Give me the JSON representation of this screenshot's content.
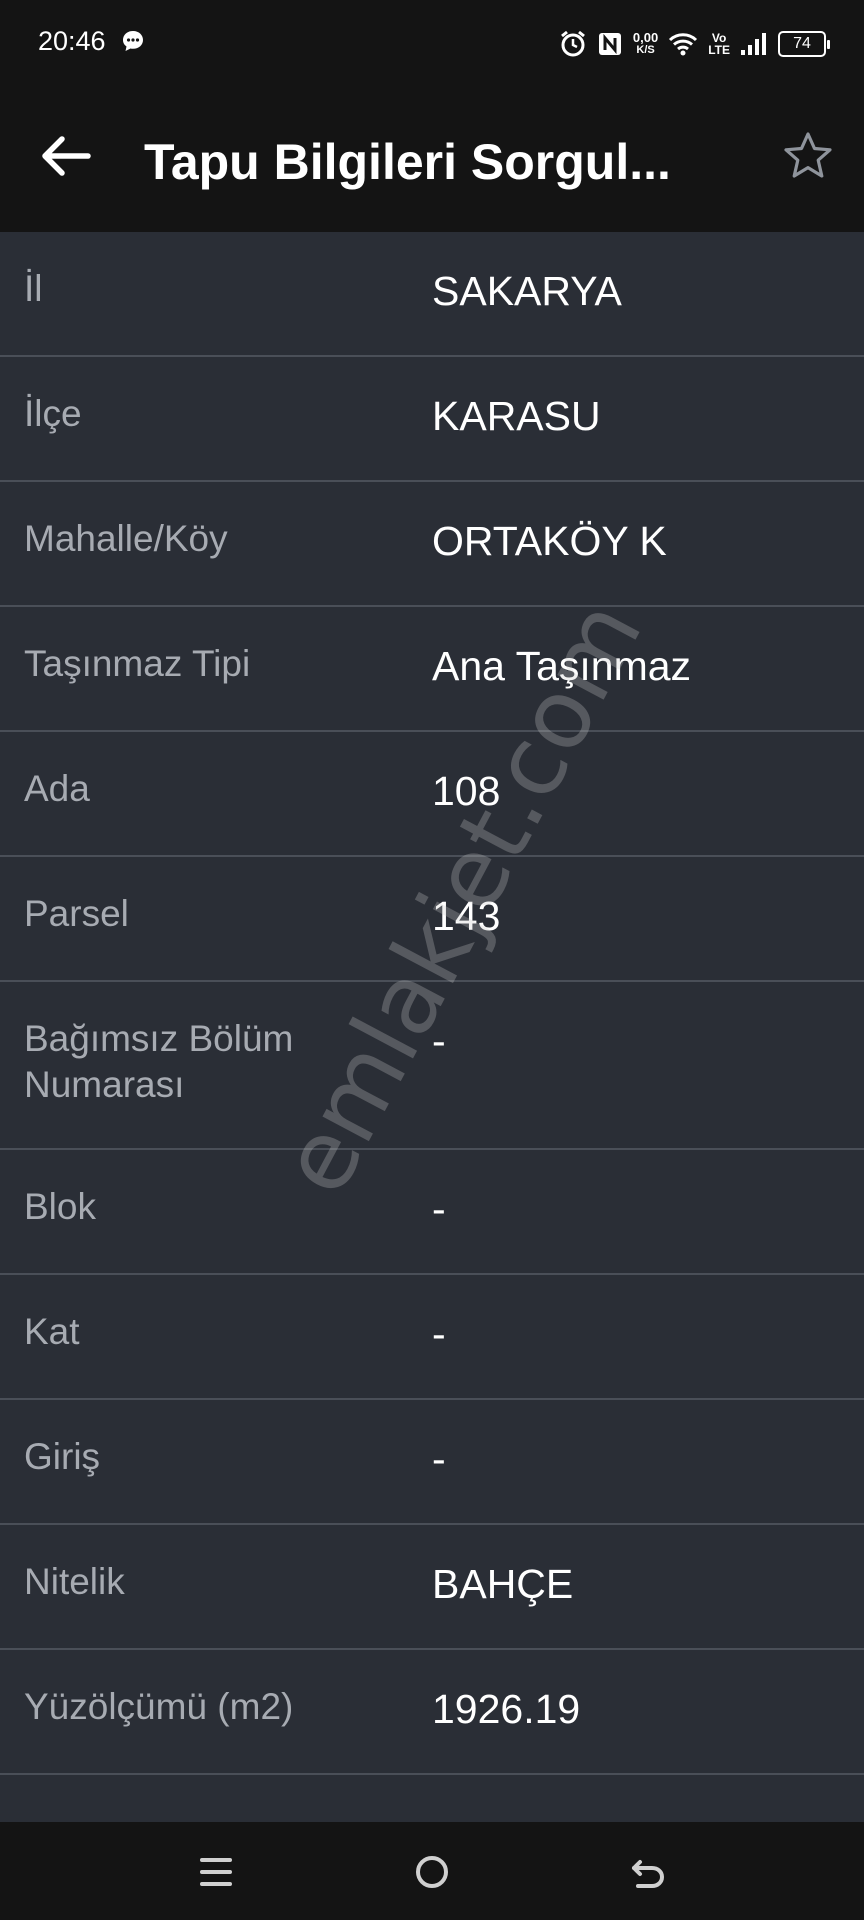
{
  "status": {
    "time": "20:46",
    "speed_value": "0,00",
    "speed_unit": "K/S",
    "volte_top": "Vo",
    "volte_bottom": "LTE",
    "battery": "74"
  },
  "header": {
    "title": "Tapu Bilgileri Sorgul..."
  },
  "rows": [
    {
      "label": "İl",
      "value": "SAKARYA"
    },
    {
      "label": "İlçe",
      "value": "KARASU"
    },
    {
      "label": "Mahalle/Köy",
      "value": "ORTAKÖY K"
    },
    {
      "label": "Taşınmaz Tipi",
      "value": "Ana Taşınmaz"
    },
    {
      "label": "Ada",
      "value": "108"
    },
    {
      "label": "Parsel",
      "value": "143"
    },
    {
      "label": "Bağımsız Bölüm Numarası",
      "value": "-"
    },
    {
      "label": "Blok",
      "value": "-"
    },
    {
      "label": "Kat",
      "value": "-"
    },
    {
      "label": "Giriş",
      "value": "-"
    },
    {
      "label": "Nitelik",
      "value": "BAHÇE"
    },
    {
      "label": "Yüzölçümü (m2)",
      "value": "1926.19"
    }
  ],
  "watermark": "emlakjet.com",
  "icons": {
    "back": "arrow-left-icon",
    "favorite": "star-outline-icon",
    "nav_menu": "menu-icon",
    "nav_home": "circle-home-icon",
    "nav_back": "back-icon"
  },
  "colors": {
    "appbar": "#141414",
    "background": "#2a2e36",
    "label": "#a7abb2",
    "value": "#ffffff",
    "divider": "#4a4f58"
  }
}
